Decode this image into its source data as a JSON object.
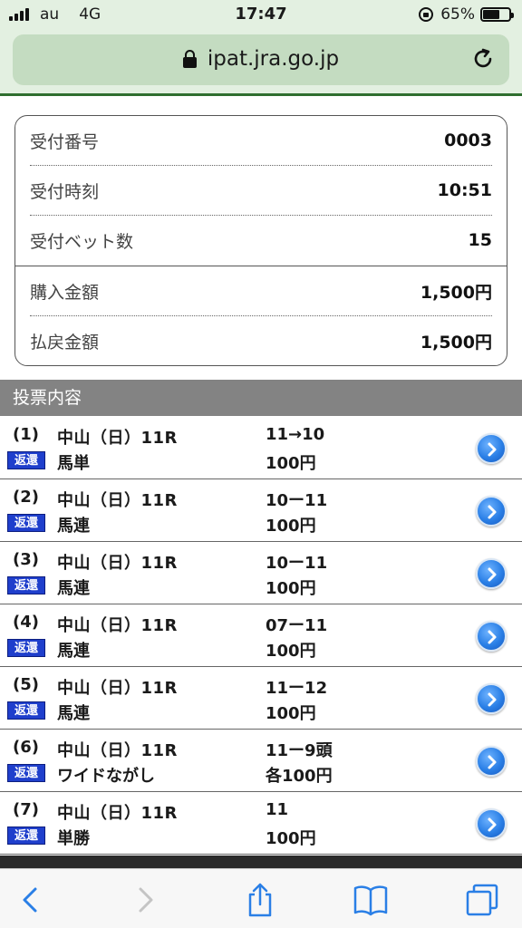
{
  "status": {
    "carrier": "au",
    "network": "4G",
    "time": "17:47",
    "battery_percent": "65%",
    "battery_level": 0.65
  },
  "address_bar": {
    "url": "ipat.jra.go.jp"
  },
  "summary": {
    "reception_number_label": "受付番号",
    "reception_number": "0003",
    "reception_time_label": "受付時刻",
    "reception_time": "10:51",
    "bet_count_label": "受付ベット数",
    "bet_count": "15",
    "purchase_amount_label": "購入金額",
    "purchase_amount": "1,500円",
    "refund_amount_label": "払戻金額",
    "refund_amount": "1,500円"
  },
  "section": {
    "title": "投票内容"
  },
  "bets": [
    {
      "no": "(1)",
      "race": "中山（日）11R",
      "badge": "返還",
      "type": "馬単",
      "combo": "11→10",
      "amount": "100円"
    },
    {
      "no": "(2)",
      "race": "中山（日）11R",
      "badge": "返還",
      "type": "馬連",
      "combo": "10ー11",
      "amount": "100円"
    },
    {
      "no": "(3)",
      "race": "中山（日）11R",
      "badge": "返還",
      "type": "馬連",
      "combo": "10ー11",
      "amount": "100円"
    },
    {
      "no": "(4)",
      "race": "中山（日）11R",
      "badge": "返還",
      "type": "馬連",
      "combo": "07ー11",
      "amount": "100円"
    },
    {
      "no": "(5)",
      "race": "中山（日）11R",
      "badge": "返還",
      "type": "馬連",
      "combo": "11ー12",
      "amount": "100円"
    },
    {
      "no": "(6)",
      "race": "中山（日）11R",
      "badge": "返還",
      "type": "ワイドながし",
      "combo": "11ー9頭",
      "amount": "各100円"
    },
    {
      "no": "(7)",
      "race": "中山（日）11R",
      "badge": "返還",
      "type": "単勝",
      "combo": "11",
      "amount": "100円"
    }
  ],
  "colors": {
    "badge": "#1f3fcc",
    "section_header": "#838383",
    "browser_chrome": "#e3f0e1",
    "accent_line": "#2f6e2f",
    "toolbar_icon": "#2a7fe6"
  },
  "icons": {
    "back": "chevron-left-icon",
    "forward": "chevron-right-icon",
    "share": "share-icon",
    "bookmarks": "book-icon",
    "tabs": "tabs-icon",
    "reload": "reload-icon",
    "detail": "arrow-circle-right-icon"
  }
}
